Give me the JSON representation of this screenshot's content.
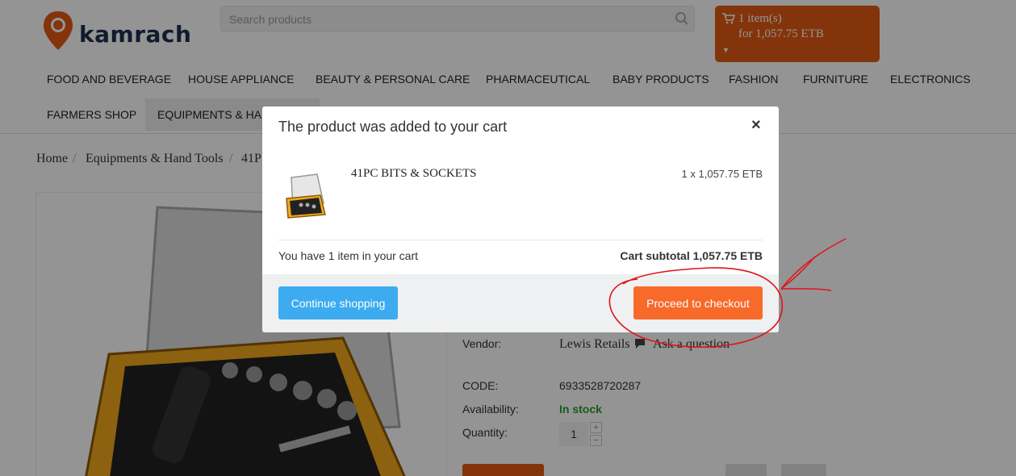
{
  "header": {
    "logo_text": "kamrach",
    "search_placeholder": "Search products",
    "cart": {
      "line1": "1 item(s)",
      "line2": "for 1,057.75 ETB"
    }
  },
  "nav": {
    "items": [
      "FOOD AND BEVERAGE",
      "HOUSE APPLIANCE",
      "BEAUTY & PERSONAL CARE",
      "PHARMACEUTICAL",
      "BABY PRODUCTS",
      "FASHION",
      "FURNITURE",
      "ELECTRONICS",
      "FARMERS SHOP",
      "EQUIPMENTS & HAN"
    ]
  },
  "breadcrumb": {
    "home": "Home",
    "category": "Equipments & Hand Tools",
    "current": "41P",
    "separator": "/"
  },
  "product": {
    "vendor_label": "Vendor:",
    "vendor_value": "Lewis Retails",
    "ask_question": "Ask a question",
    "code_label": "CODE:",
    "code_value": "6933528720287",
    "availability_label": "Availability:",
    "availability_value": "In stock",
    "quantity_label": "Quantity:",
    "quantity_value": "1",
    "qty_plus": "+",
    "qty_minus": "−"
  },
  "modal": {
    "title": "The product was added to your cart",
    "close": "×",
    "product_name": "41PC BITS & SOCKETS",
    "product_price": "1 x 1,057.75 ETB",
    "cart_count_text": "You have 1 item in your cart",
    "cart_subtotal": "Cart subtotal 1,057.75 ETB",
    "continue_label": "Continue shopping",
    "checkout_label": "Proceed to checkout"
  },
  "colors": {
    "accent_orange": "#e35a13",
    "checkout_orange": "#f86a2a",
    "continue_blue": "#3cabef",
    "stock_green": "#2b9a2b",
    "annotation_red": "#e0141c"
  }
}
